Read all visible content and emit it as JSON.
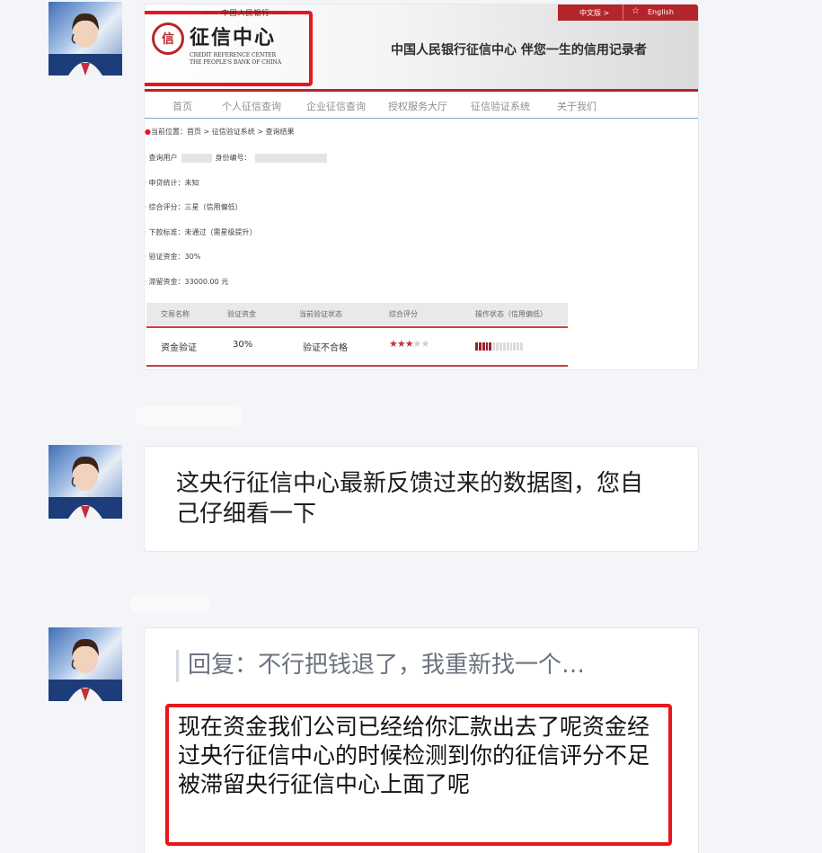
{
  "colors": {
    "accent_red": "#b3252a",
    "highlight_red": "#e8161d",
    "star_red": "#c0323a"
  },
  "screenshot": {
    "logo": {
      "icon": "credit-seal-icon",
      "top_text": "—— 中国人民银行 ——",
      "main_text": "征信中心",
      "en_line1": "CREDIT REFERENCE CENTER",
      "en_line2": "THE PEOPLE'S BANK OF CHINA"
    },
    "tagline": "中国人民银行征信中心 伴您一生的信用记录者",
    "top_links": {
      "chinese": "中文版 >",
      "english": "English",
      "english_icon": "star-outline-icon"
    },
    "nav": [
      "首页",
      "个人征信查询",
      "企业征信查询",
      "授权服务大厅",
      "征信验证系统",
      "关于我们"
    ],
    "breadcrumb": "当前位置：首页 > 征信验证系统 > 查询结果",
    "fields": {
      "query_user_label": "查询用户",
      "id_label": "身份编号：",
      "loan_stats": "申贷统计：未知",
      "overall_score": "综合评分：三星（信用偏低）",
      "loan_standard": "下款标准：未通过（需星级提升）",
      "verify_funds": "验证资金：30%",
      "detained_funds": "滞留资金：33000.00 元"
    },
    "table": {
      "headers": [
        "交易名称",
        "验证资金",
        "当前验证状态",
        "综合评分",
        "操作状态（信用偏低）"
      ],
      "row": {
        "name": "资金验证",
        "funds": "30%",
        "status": "验证不合格",
        "stars_filled": 3,
        "stars_total": 5,
        "progress_fraction": 0.35
      }
    }
  },
  "messages": {
    "msg2": "这央行征信中心最新反馈过来的数据图，您自己仔细看一下",
    "msg3_quote": "回复：不行把钱退了，我重新找一个…",
    "msg3": "现在资金我们公司已经给你汇款出去了呢资金经过央行征信中心的时候检测到你的征信评分不足被滞留央行征信中心上面了呢"
  }
}
